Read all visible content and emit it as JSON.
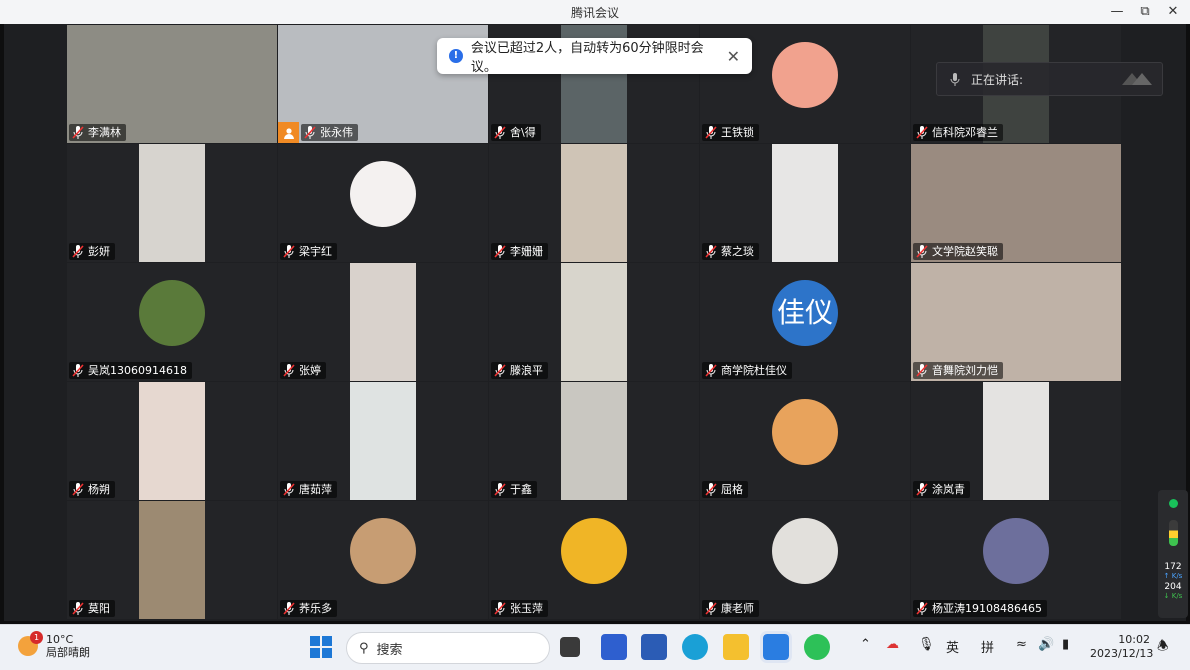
{
  "window": {
    "title": "腾讯会议",
    "minimize_icon": "minimize-icon",
    "restore_icon": "restore-icon",
    "close_icon": "close-icon"
  },
  "notice": {
    "text": "会议已超过2人，自动转为60分钟限时会议。",
    "info_icon": "info-icon"
  },
  "speaking": {
    "label": "正在讲话:"
  },
  "participants": [
    {
      "name": "李满林",
      "kind": "video",
      "style": "full",
      "bg": "#8d8c84",
      "host": false
    },
    {
      "name": "张永伟",
      "kind": "video",
      "style": "full",
      "bg": "#b9bcc0",
      "host": true
    },
    {
      "name": "舍\\得",
      "kind": "video",
      "style": "portrait",
      "bg": "#5b6466",
      "host": false
    },
    {
      "name": "王铁锁",
      "kind": "avatar",
      "bg": "#f1a28e",
      "host": false
    },
    {
      "name": "信科院邓睿兰",
      "kind": "video",
      "style": "portrait",
      "bg": "#3f4340",
      "host": false
    },
    {
      "name": "彭妍",
      "kind": "video",
      "style": "portrait",
      "bg": "#d7d4cf",
      "host": false
    },
    {
      "name": "梁宇红",
      "kind": "avatar",
      "bg": "#f4f1f0",
      "host": false
    },
    {
      "name": "李姗姗",
      "kind": "video",
      "style": "portrait",
      "bg": "#cfc4b6",
      "host": false
    },
    {
      "name": "蔡之琰",
      "kind": "video",
      "style": "portrait",
      "bg": "#e7e6e5",
      "host": false
    },
    {
      "name": "文学院赵笑聪",
      "kind": "video",
      "style": "full",
      "bg": "#9a8b80",
      "host": false
    },
    {
      "name": "吴岚13060914618",
      "kind": "avatar",
      "bg": "#5a7a3a",
      "host": false
    },
    {
      "name": "张婷",
      "kind": "video",
      "style": "portrait",
      "bg": "#d9d2cc",
      "host": false
    },
    {
      "name": "滕浪平",
      "kind": "video",
      "style": "portrait",
      "bg": "#d8d5cc",
      "host": false
    },
    {
      "name": "商学院杜佳仪",
      "kind": "text-avatar",
      "avatar_text": "佳仪",
      "bg": "#2d74c9",
      "host": false
    },
    {
      "name": "音舞院刘力恺",
      "kind": "video",
      "style": "full",
      "bg": "#bfb2a7",
      "host": false
    },
    {
      "name": "杨朔",
      "kind": "video",
      "style": "portrait",
      "bg": "#e6d8d0",
      "host": false
    },
    {
      "name": "唐茹萍",
      "kind": "video",
      "style": "portrait",
      "bg": "#dfe3e2",
      "host": false
    },
    {
      "name": "于鑫",
      "kind": "video",
      "style": "portrait",
      "bg": "#c9c7c1",
      "host": false
    },
    {
      "name": "屈格",
      "kind": "avatar",
      "bg": "#e8a35c",
      "host": false
    },
    {
      "name": "涂岚青",
      "kind": "video",
      "style": "portrait",
      "bg": "#e4e3e1",
      "host": false
    },
    {
      "name": "莫阳",
      "kind": "video",
      "style": "portrait",
      "bg": "#9c8a72",
      "host": false
    },
    {
      "name": "荞乐多",
      "kind": "avatar",
      "bg": "#c79d73",
      "host": false
    },
    {
      "name": "张玉萍",
      "kind": "avatar",
      "bg": "#f0b526",
      "host": false
    },
    {
      "name": "康老师",
      "kind": "avatar",
      "bg": "#e2e0dc",
      "host": false
    },
    {
      "name": "杨亚涛19108486465",
      "kind": "avatar",
      "bg": "#6d6f9c",
      "host": false
    }
  ],
  "network": {
    "up_value": "172",
    "up_unit": "K/s",
    "down_value": "204",
    "down_unit": "K/s"
  },
  "taskbar": {
    "weather_temp": "10°C",
    "weather_desc": "局部晴朗",
    "weather_badge": "1",
    "search_placeholder": "搜索",
    "ime_lang": "英",
    "ime_mode": "拼",
    "time": "10:02",
    "date": "2023/12/13"
  },
  "colors": {
    "accent": "#2a6ee8",
    "host_badge": "#f08a24",
    "stage_bg": "#1e1f22"
  }
}
